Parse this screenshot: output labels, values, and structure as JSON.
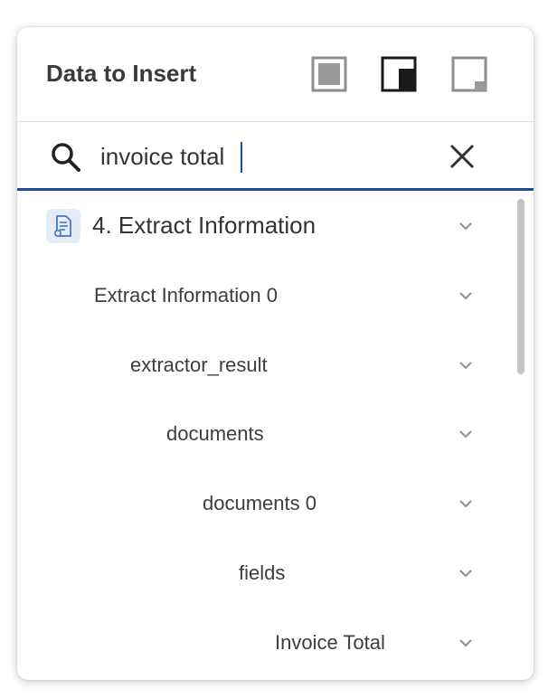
{
  "header": {
    "title": "Data to Insert",
    "view_buttons": [
      {
        "icon": "full-view-icon",
        "state": "inactive"
      },
      {
        "icon": "split-view-icon",
        "state": "active"
      },
      {
        "icon": "collapsed-view-icon",
        "state": "inactive"
      }
    ]
  },
  "search": {
    "icon": "search-icon",
    "value": "invoice total",
    "placeholder": "",
    "clear_icon": "close-icon"
  },
  "tree": {
    "items": [
      {
        "label": "4. Extract Information",
        "level": 0,
        "icon": "document-step-icon"
      },
      {
        "label": "Extract Information 0",
        "level": 1
      },
      {
        "label": "extractor_result",
        "level": 2
      },
      {
        "label": "documents",
        "level": 3
      },
      {
        "label": "documents 0",
        "level": 4
      },
      {
        "label": "fields",
        "level": 5
      },
      {
        "label": "Invoice Total",
        "level": 6
      }
    ],
    "expand_icon": "chevron-down-icon"
  },
  "colors": {
    "accent": "#1f4e96",
    "text": "#333333",
    "icon_inactive": "#8e8e8e",
    "step_icon_bg": "#e6ecf6"
  }
}
